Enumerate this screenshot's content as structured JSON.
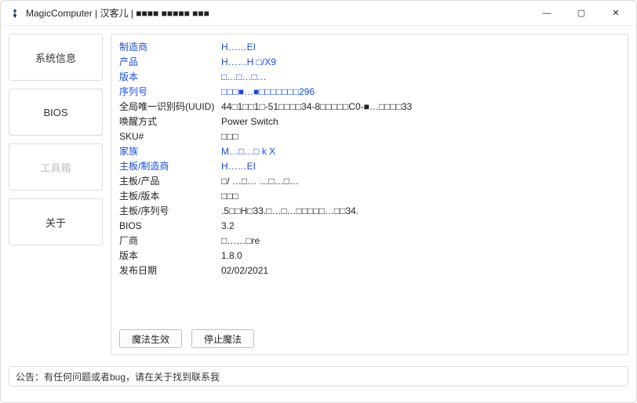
{
  "window": {
    "title": "MagicComputer | 汉客儿 | ■■■■ ■■■■■ ■■■",
    "minimize": "—",
    "maximize": "▢",
    "close": "✕"
  },
  "sidebar": {
    "items": [
      {
        "label": "系统信息",
        "disabled": false
      },
      {
        "label": "BIOS",
        "disabled": false
      },
      {
        "label": "工具箱",
        "disabled": true
      },
      {
        "label": "关于",
        "disabled": false
      }
    ]
  },
  "info": {
    "rows": [
      {
        "key": "制造商",
        "val": "H……EI",
        "blue": true
      },
      {
        "key": "产品",
        "val": "H……H □/X9",
        "blue": true
      },
      {
        "key": "版本",
        "val": "□…□…□…",
        "blue": true
      },
      {
        "key": "序列号",
        "val": "□□□■…■□□□□□□□296",
        "blue": true
      },
      {
        "key": "全局唯一识别码(UUID)",
        "val": "44□1□□1□-51□□□□34-8□□□□□C0-■…□□□□33",
        "blue": false
      },
      {
        "key": "唤醒方式",
        "val": "Power Switch",
        "blue": false
      },
      {
        "key": "SKU#",
        "val": "□□□",
        "blue": false
      },
      {
        "key": "家族",
        "val": "M…□…□ k X",
        "blue": true
      },
      {
        "key": "主板/制造商",
        "val": "H……EI",
        "blue": true
      },
      {
        "key": "主板/产品",
        "val": "□/ …□… …□…□…",
        "blue": false
      },
      {
        "key": "主板/版本",
        "val": "□□□",
        "blue": false
      },
      {
        "key": "主板/序列号",
        "val": ".5□□H□33.□…□…□□□□□…□□34.",
        "blue": false
      },
      {
        "key": "BIOS",
        "val": "3.2",
        "blue": false
      },
      {
        "key": "厂商",
        "val": "□……□re",
        "blue": false
      },
      {
        "key": "版本",
        "val": "1.8.0",
        "blue": false
      },
      {
        "key": "发布日期",
        "val": "02/02/2021",
        "blue": false
      }
    ]
  },
  "buttons": {
    "apply": "魔法生效",
    "stop": "停止魔法"
  },
  "footer": {
    "text": "公告：有任何问题或者bug，请在关于找到联系我"
  }
}
